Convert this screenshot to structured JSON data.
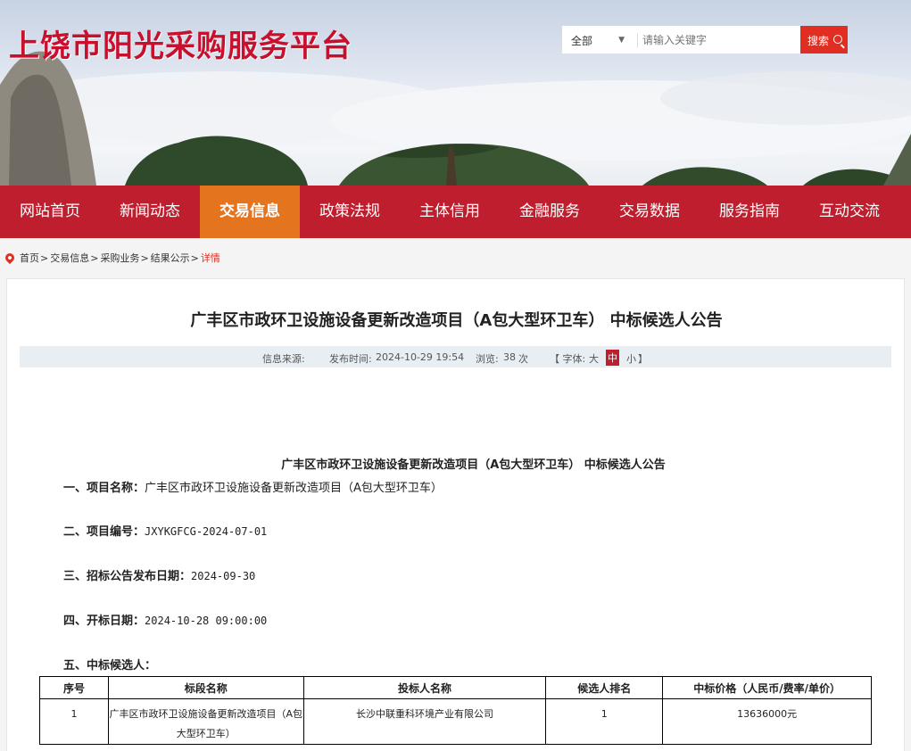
{
  "header": {
    "site_title": "上饶市阳光采购服务平台",
    "search": {
      "scope": "全部",
      "placeholder": "请输入关键字",
      "button": "搜索"
    }
  },
  "nav": {
    "items": [
      {
        "label": "网站首页"
      },
      {
        "label": "新闻动态"
      },
      {
        "label": "交易信息",
        "active": true
      },
      {
        "label": "政策法规"
      },
      {
        "label": "主体信用"
      },
      {
        "label": "金融服务"
      },
      {
        "label": "交易数据"
      },
      {
        "label": "服务指南"
      },
      {
        "label": "互动交流"
      }
    ]
  },
  "breadcrumb": {
    "items": [
      "首页",
      "交易信息",
      "采购业务",
      "结果公示"
    ],
    "current": "详情"
  },
  "article": {
    "title": "广丰区市政环卫设施设备更新改造项目（A包大型环卫车） 中标候选人公告",
    "meta": {
      "source_label": "信息来源:",
      "time_label": "发布时间:",
      "time": "2024-10-29 19:54",
      "views_label": "浏览:",
      "views": "38",
      "views_unit": "次",
      "font_open": "【 字体:",
      "font_large": "大",
      "font_medium": "中",
      "font_small": "小",
      "font_close": "】"
    },
    "subtitle": "广丰区市政环卫设施设备更新改造项目（A包大型环卫车） 中标候选人公告",
    "sections": {
      "project_name_label": "一、项目名称：",
      "project_name": "广丰区市政环卫设施设备更新改造项目（A包大型环卫车）",
      "project_no_label": "二、项目编号：",
      "project_no": "JXYKGFCG-2024-07-01",
      "notice_date_label": "三、招标公告发布日期：",
      "notice_date": "2024-09-30",
      "open_date_label": "四、开标日期：",
      "open_date": "2024-10-28 09:00:00",
      "candidates_label": "五、中标候选人："
    },
    "table": {
      "headers": [
        "序号",
        "标段名称",
        "投标人名称",
        "候选人排名",
        "中标价格（人民币/费率/单价）"
      ],
      "rows": [
        [
          "1",
          "广丰区市政环卫设施设备更新改造项目（A包大型环卫车）",
          "长沙中联重科环境产业有限公司",
          "1",
          "13636000元"
        ]
      ]
    }
  }
}
